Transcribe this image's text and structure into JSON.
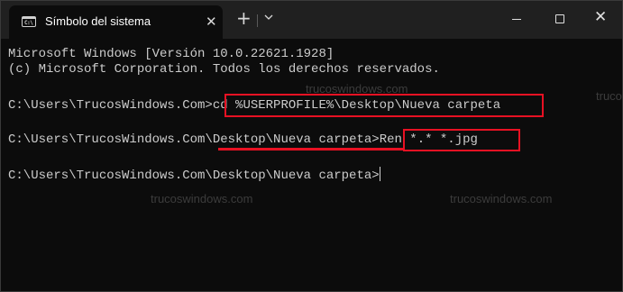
{
  "titlebar": {
    "tab_title": "Símbolo del sistema",
    "tab_icon": "cmd-icon",
    "close_tab_glyph": "✕",
    "new_tab_glyph": "+",
    "dropdown_icon": "chevron-down-icon",
    "window_controls": [
      "minimize-icon",
      "maximize-icon",
      "close-icon"
    ],
    "window_close_glyph": "✕"
  },
  "terminal": {
    "header_line1": "Microsoft Windows [Versión 10.0.22621.1928]",
    "header_line2": "(c) Microsoft Corporation. Todos los derechos reservados.",
    "prompt1": "C:\\Users\\TrucosWindows.Com>",
    "command1": "cd %USERPROFILE%\\Desktop\\Nueva carpeta",
    "prompt2_base": "C:\\Users\\TrucosWindows.Com",
    "prompt2_path": "\\Desktop\\Nueva carpeta",
    "prompt2_end": ">",
    "command2": "Ren *.* *.jpg",
    "prompt3": "C:\\Users\\TrucosWindows.Com\\Desktop\\Nueva carpeta>"
  },
  "watermarks": [
    "trucoswindows.com",
    "trucoswindows.com",
    "trucoswindows.com",
    "trucoswindows.com"
  ],
  "colors": {
    "background": "#0c0c0c",
    "titlebar": "#202020",
    "text": "#cccccc",
    "highlight": "#e81123"
  }
}
